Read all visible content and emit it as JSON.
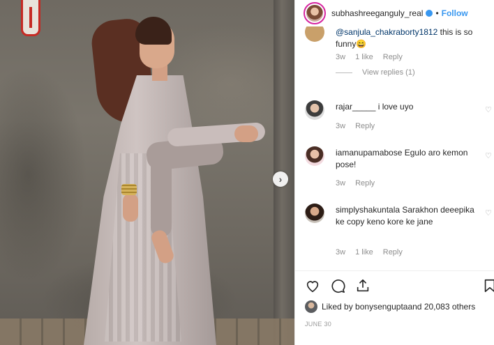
{
  "post": {
    "username": "subhashreeganguly_real",
    "separator": "•",
    "follow_label": "Follow"
  },
  "comments": [
    {
      "mention": "@sanjula_chakraborty1812",
      "text": " this is so funny😄",
      "time": "3w",
      "likes": "1 like",
      "reply_label": "Reply",
      "view_replies": "View replies (1)"
    },
    {
      "user": "rajar_____",
      "text": " i love uyo",
      "time": "3w",
      "reply_label": "Reply"
    },
    {
      "user": "iamanupamabose",
      "text": " Egulo aro kemon pose!",
      "time": "3w",
      "reply_label": "Reply"
    },
    {
      "user": "simplyshakuntala",
      "text": " Sarakhon deeepika ke copy keno kore ke jane",
      "time": "3w",
      "likes": "1 like",
      "reply_label": "Reply"
    }
  ],
  "likes": {
    "prefix": "Liked by ",
    "user": "bonysengupta",
    "middle": " and ",
    "count": "20,083 others"
  },
  "date": "JUNE 30",
  "icons": [
    "heart-icon",
    "comment-icon",
    "share-icon",
    "bookmark-icon",
    "chevron-right-icon",
    "verified-icon"
  ],
  "colors": {
    "accent": "#3897f0",
    "text": "#262626",
    "muted": "#8e8e8e"
  }
}
